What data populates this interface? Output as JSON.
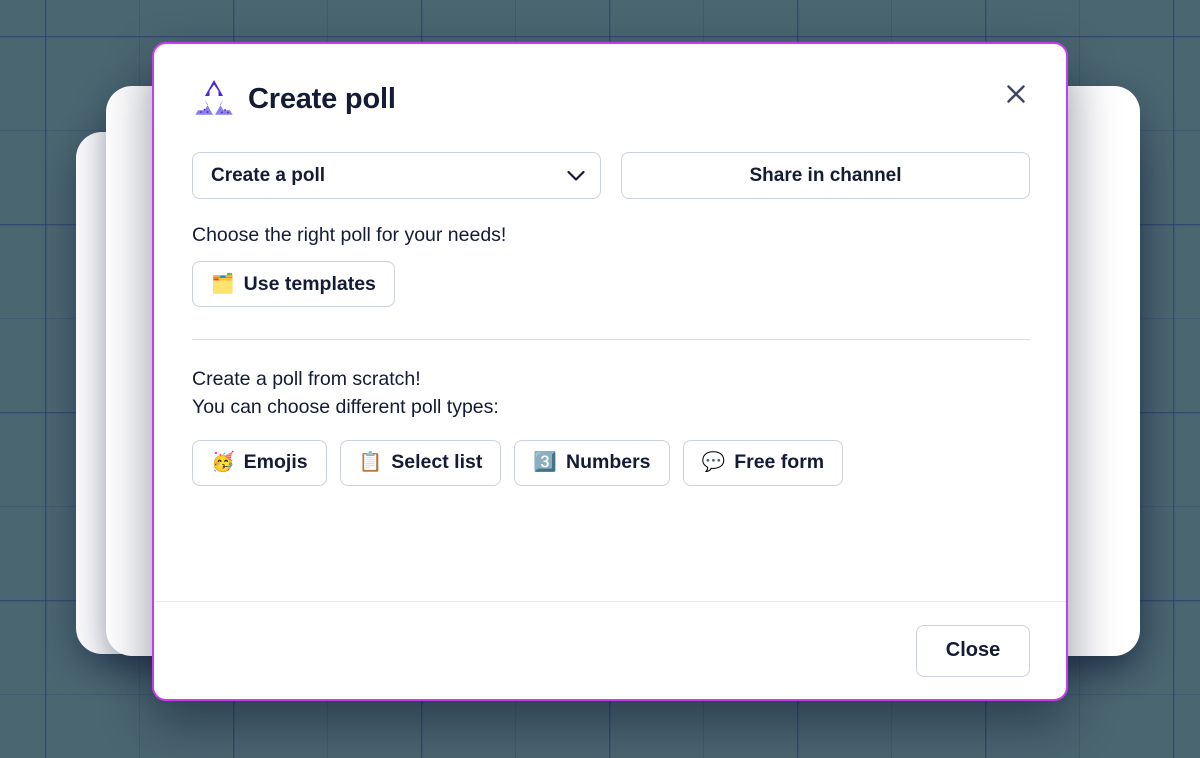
{
  "background": {
    "color": "#4a6670",
    "grid_line_color": "#2a3e6e"
  },
  "modal": {
    "border_color": "#c83cf0",
    "logo_icon": "polly-triangle-logo-icon",
    "title": "Create poll",
    "close_icon": "close-icon",
    "poll_mode_select": {
      "selected": "Create a poll",
      "options": [
        "Create a poll"
      ],
      "chevron_icon": "chevron-down-icon"
    },
    "share_button": "Share in channel",
    "choose_text": "Choose the right poll for your needs!",
    "templates_button": {
      "emoji": "🗂️",
      "emoji_name": "card-index-dividers-icon",
      "label": "Use templates"
    },
    "scratch_line1": "Create a poll from scratch!",
    "scratch_line2": "You can choose different poll types:",
    "poll_types": [
      {
        "emoji": "🥳",
        "emoji_name": "partying-face-icon",
        "label": "Emojis"
      },
      {
        "emoji": "📋",
        "emoji_name": "clipboard-icon",
        "label": "Select list"
      },
      {
        "emoji": "3️⃣",
        "emoji_name": "keycap-three-icon",
        "label": "Numbers"
      },
      {
        "emoji": "💬",
        "emoji_name": "speech-balloon-icon",
        "label": "Free form"
      }
    ],
    "footer": {
      "close_label": "Close"
    }
  }
}
